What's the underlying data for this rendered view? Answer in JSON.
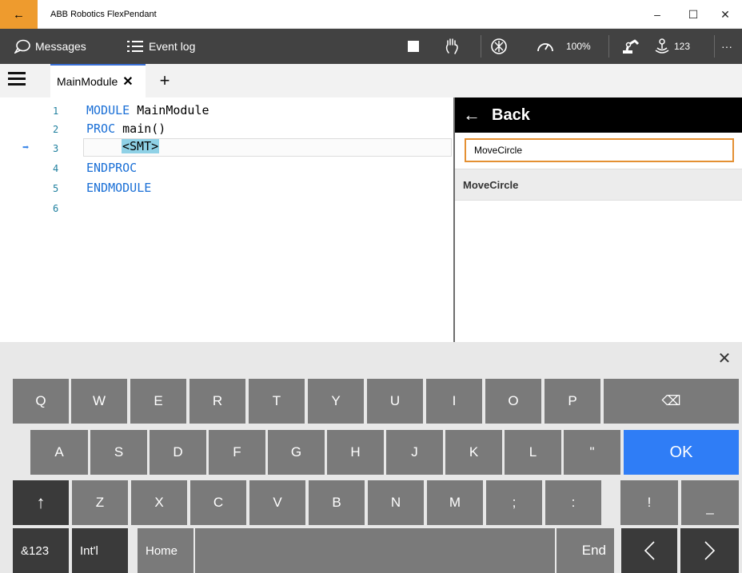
{
  "titlebar": {
    "back_icon": "←",
    "title": "ABB Robotics FlexPendant",
    "minimize": "–",
    "maximize": "☐",
    "close": "✕"
  },
  "toolbar": {
    "messages_label": "Messages",
    "event_log_label": "Event log",
    "speed_value": "100%",
    "counter_value": "123",
    "more_icon": "···"
  },
  "tabs": {
    "main_label": "MainModule",
    "close_icon": "✕",
    "add_icon": "+"
  },
  "editor": {
    "lines": [
      {
        "num": "1",
        "kw": "MODULE",
        "rest": " MainModule"
      },
      {
        "num": "2",
        "kw": "PROC",
        "rest": " main()"
      },
      {
        "num": "3",
        "placeholder": "<SMT>"
      },
      {
        "num": "4",
        "kw": "ENDPROC",
        "rest": ""
      },
      {
        "num": "5",
        "kw": "ENDMODULE",
        "rest": ""
      },
      {
        "num": "6",
        "kw": "",
        "rest": ""
      }
    ],
    "program_pointer_icon": "➡"
  },
  "panel": {
    "back_icon": "←",
    "back_label": "Back",
    "search_value": "MoveCircle",
    "result_label": "MoveCircle"
  },
  "keyboard": {
    "close_icon": "✕",
    "row1": [
      "Q",
      "W",
      "E",
      "R",
      "T",
      "Y",
      "U",
      "I",
      "O",
      "P",
      "⌫"
    ],
    "row2": [
      "A",
      "S",
      "D",
      "F",
      "G",
      "H",
      "J",
      "K",
      "L",
      "\"",
      "OK"
    ],
    "row3": [
      "↑",
      "Z",
      "X",
      "C",
      "V",
      "B",
      "N",
      "M",
      ";",
      ":",
      "!",
      "_"
    ],
    "row4": {
      "num": "&123",
      "intl": "Int'l",
      "home": "Home",
      "space": "",
      "end": "End",
      "left": "〈",
      "right": "〉"
    }
  },
  "colors": {
    "accent_orange": "#ee9b2e",
    "toolbar_bg": "#424242",
    "keyword_blue": "#1a6fd6",
    "ok_blue": "#2f7df6",
    "key_gray": "#7a7a7a",
    "key_dark": "#3a3a3a"
  }
}
